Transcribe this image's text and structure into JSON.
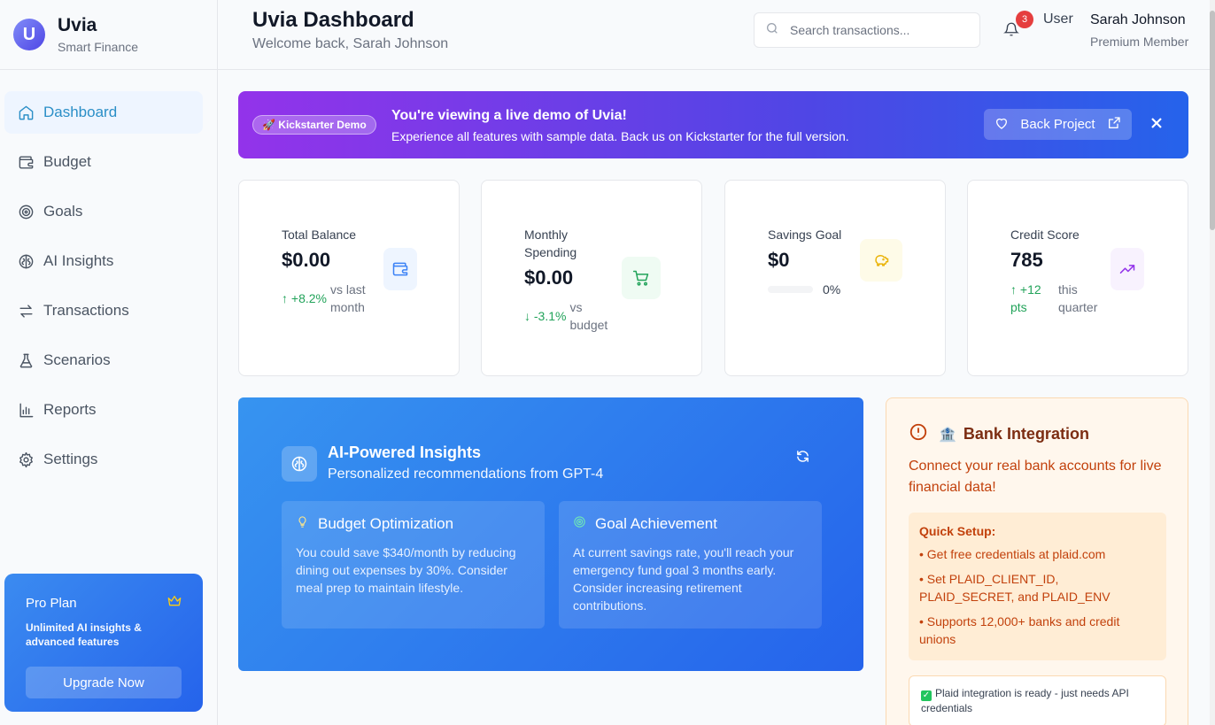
{
  "brand": {
    "logo_letter": "U",
    "name": "Uvia",
    "subtitle": "Smart Finance"
  },
  "sidebar": {
    "items": [
      {
        "label": "Dashboard",
        "icon": "home-icon",
        "active": true
      },
      {
        "label": "Budget",
        "icon": "wallet-icon"
      },
      {
        "label": "Goals",
        "icon": "target-icon"
      },
      {
        "label": "AI Insights",
        "icon": "brain-icon"
      },
      {
        "label": "Transactions",
        "icon": "arrows-exchange-icon"
      },
      {
        "label": "Scenarios",
        "icon": "flask-icon"
      },
      {
        "label": "Reports",
        "icon": "bar-chart-icon"
      },
      {
        "label": "Settings",
        "icon": "gear-icon"
      }
    ],
    "pro": {
      "title": "Pro Plan",
      "description": "Unlimited AI insights & advanced features",
      "button": "Upgrade Now",
      "icon": "crown-icon"
    }
  },
  "header": {
    "title": "Uvia Dashboard",
    "welcome": "Welcome back, Sarah Johnson",
    "search_placeholder": "Search transactions...",
    "notification_count": "3",
    "avatar_alt": "User",
    "user_name": "Sarah Johnson",
    "user_role": "Premium Member"
  },
  "banner": {
    "pill": "🚀 Kickstarter Demo",
    "title": "You're viewing a live demo of Uvia!",
    "subtitle": "Experience all features with sample data. Back us on Kickstarter for the full version.",
    "button": "Back Project"
  },
  "stats": {
    "balance": {
      "label": "Total Balance",
      "value": "$0.00",
      "trend": "↑ +8.2%",
      "context": "vs last month",
      "icon": "wallet-icon",
      "color": "#3b82f6"
    },
    "spending": {
      "label": "Monthly Spending",
      "value": "$0.00",
      "trend": "↓ -3.1%",
      "context": "vs budget",
      "icon": "cart-icon",
      "color": "#22a35a"
    },
    "savings": {
      "label": "Savings Goal",
      "value": "$0",
      "progress_percent": 0,
      "progress_text": "0%",
      "icon": "piggy-bank-icon",
      "color": "#eab308"
    },
    "credit": {
      "label": "Credit Score",
      "value": "785",
      "trend": "↑ +12 pts",
      "context": "this quarter",
      "icon": "trending-up-icon",
      "color": "#9333ea"
    }
  },
  "ai": {
    "title": "AI-Powered Insights",
    "subtitle": "Personalized recommendations from GPT-4",
    "cards": [
      {
        "title": "Budget Optimization",
        "icon": "lightbulb-icon",
        "body": "You could save $340/month by reducing dining out expenses by 30%. Consider meal prep to maintain lifestyle."
      },
      {
        "title": "Goal Achievement",
        "icon": "target-icon",
        "body": "At current savings rate, you'll reach your emergency fund goal 3 months early. Consider increasing retirement contributions."
      }
    ]
  },
  "bank": {
    "title": "Bank Integration",
    "emoji": "🏦",
    "description": "Connect your real bank accounts for live financial data!",
    "setup_title": "Quick Setup:",
    "setup_items": [
      "• Get free credentials at plaid.com",
      "• Set PLAID_CLIENT_ID, PLAID_SECRET, and PLAID_ENV",
      "• Supports 12,000+ banks and credit unions"
    ],
    "ready": "Plaid integration is ready - just needs API credentials"
  }
}
